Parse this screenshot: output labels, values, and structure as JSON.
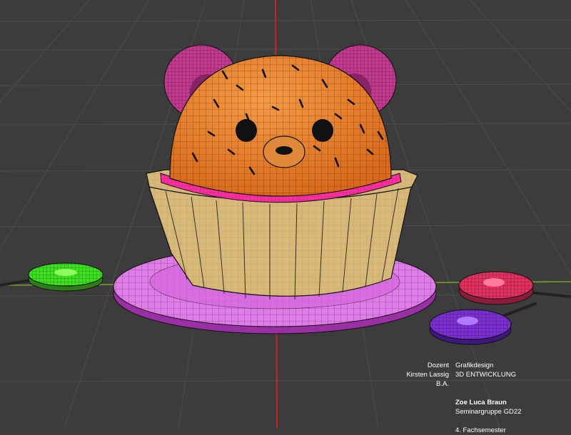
{
  "scene": {
    "subject": "bear cupcake wireframe model",
    "colors": {
      "background": "#3c3c3c",
      "grid": "#4a4a4a",
      "axis_red": "#c0282e",
      "axis_green": "#7a9a2a",
      "dome": "#e37d2b",
      "ears": "#c23a8f",
      "frosting_ring": "#ff2fa0",
      "wrapper": "#d7b879",
      "plate": "#e07ce8",
      "candy_green": "#3ddf20",
      "candy_red": "#e0305e",
      "candy_purple": "#7a2fd0"
    }
  },
  "credits": {
    "dozent_label": "Dozent",
    "dozent_name": "Kirsten Lassig B.A.",
    "department": "Grafikdesign",
    "course": "3D ENTWICKLUNG",
    "student_name": "Zoe Luca Braun",
    "group": "Seminargruppe GD22",
    "semester": "4. Fachsemester"
  }
}
